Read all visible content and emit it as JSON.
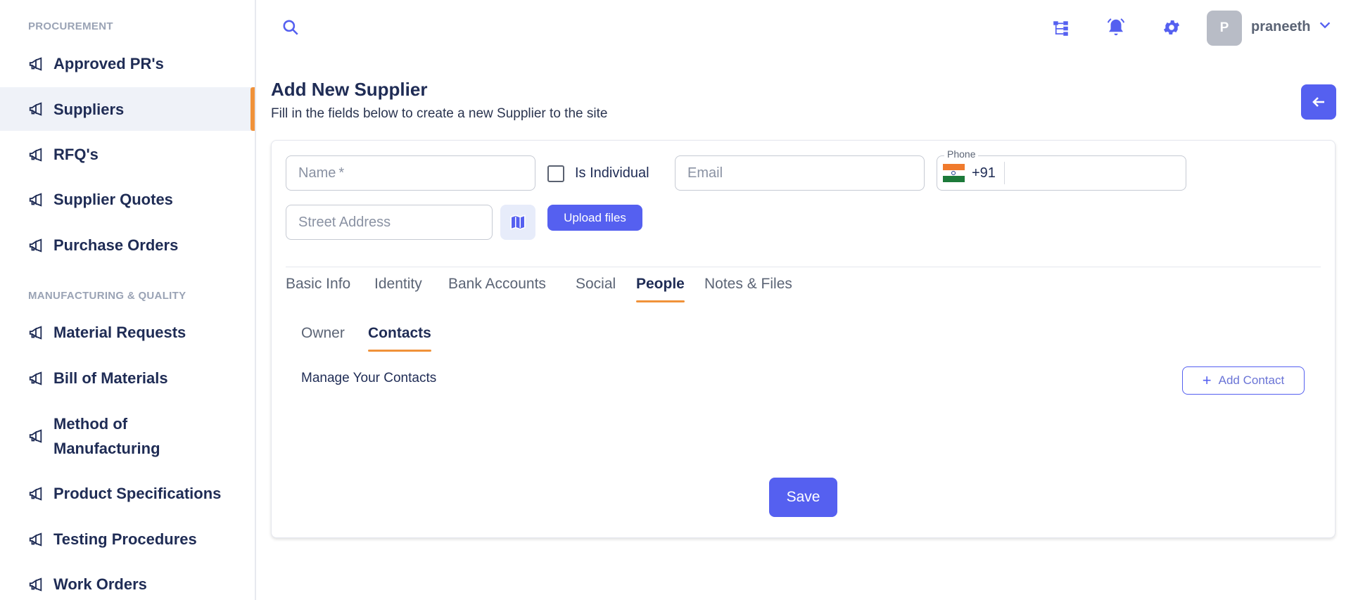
{
  "sidebar": {
    "sections": [
      {
        "title": "PROCUREMENT",
        "items": [
          {
            "label": "Approved PR's",
            "icon": "megaphone-icon"
          },
          {
            "label": "Suppliers",
            "icon": "megaphone-icon",
            "active": true
          },
          {
            "label": "RFQ's",
            "icon": "megaphone-icon"
          },
          {
            "label": "Supplier Quotes",
            "icon": "megaphone-icon"
          },
          {
            "label": "Purchase Orders",
            "icon": "megaphone-icon"
          }
        ]
      },
      {
        "title": "MANUFACTURING & QUALITY",
        "items": [
          {
            "label": "Material Requests",
            "icon": "megaphone-icon"
          },
          {
            "label": "Bill of Materials",
            "icon": "megaphone-icon"
          },
          {
            "label": "Method of Manufacturing",
            "icon": "megaphone-icon"
          },
          {
            "label": "Product Specifications",
            "icon": "megaphone-icon"
          },
          {
            "label": "Testing Procedures",
            "icon": "megaphone-icon"
          },
          {
            "label": "Work Orders",
            "icon": "megaphone-icon"
          }
        ]
      }
    ]
  },
  "topbar": {
    "icons": [
      "search-icon",
      "hierarchy-icon",
      "bell-icon",
      "gear-icon"
    ],
    "user": {
      "initial": "P",
      "name": "praneeth"
    }
  },
  "page": {
    "title": "Add New Supplier",
    "subtitle": "Fill in the fields below to create a new Supplier to the site"
  },
  "form": {
    "name_placeholder": "Name",
    "required_mark": "*",
    "is_individual_label": "Is Individual",
    "email_placeholder": "Email",
    "phone_legend": "Phone",
    "phone_code": "+91",
    "street_placeholder": "Street Address",
    "upload_label": "Upload files"
  },
  "tabs": {
    "items": [
      "Basic Info",
      "Identity",
      "Bank Accounts",
      "Social",
      "People",
      "Notes & Files"
    ],
    "active": "People"
  },
  "subtabs": {
    "items": [
      "Owner",
      "Contacts"
    ],
    "active": "Contacts"
  },
  "contacts": {
    "heading": "Manage Your Contacts",
    "add_label": "Add Contact"
  },
  "save_label": "Save",
  "colors": {
    "primary": "#5560f0",
    "accent": "#f0923a",
    "nav_text": "#1f2c55",
    "muted": "#9aa3b5"
  }
}
